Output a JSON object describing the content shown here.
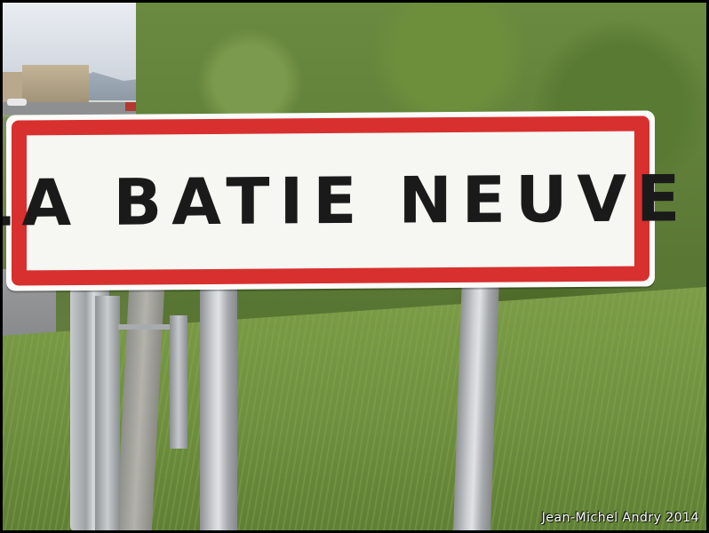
{
  "sign": {
    "text": "LA BATIE NEUVE",
    "border_color": "#d8302e",
    "background_color": "#f6f6f3",
    "text_color": "#1a1a1a"
  },
  "credit": {
    "text": "Jean-Michel Andry 2014"
  }
}
